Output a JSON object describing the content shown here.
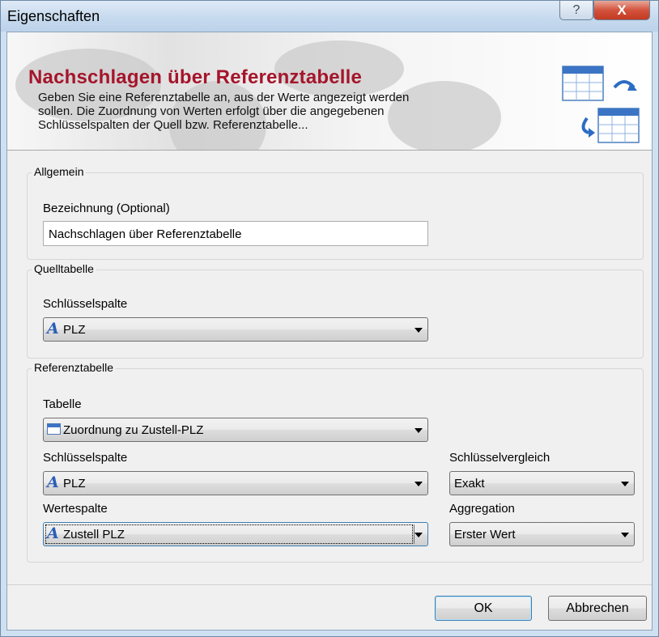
{
  "window": {
    "title": "Eigenschaften",
    "help_label": "?",
    "close_label": "X"
  },
  "banner": {
    "title": "Nachschlagen über Referenztabelle",
    "description_lines": [
      "Geben Sie eine Referenztabelle an, aus der Werte angezeigt werden",
      "sollen. Die Zuordnung von Werten erfolgt über die angegebenen",
      "Schlüsselspalten der Quell bzw. Referenztabelle..."
    ],
    "icon": "table-lookup-icon"
  },
  "allgemein": {
    "legend": "Allgemein",
    "name_label": "Bezeichnung (Optional)",
    "name_value": "Nachschlagen über Referenztabelle"
  },
  "quelltabelle": {
    "legend": "Quelltabelle",
    "key_label": "Schlüsselspalte",
    "key_value": "PLZ",
    "key_icon": "text-column-icon"
  },
  "referenztabelle": {
    "legend": "Referenztabelle",
    "table_label": "Tabelle",
    "table_value": "Zuordnung zu Zustell-PLZ",
    "table_icon": "table-icon",
    "key_label": "Schlüsselspalte",
    "key_value": "PLZ",
    "compare_label": "Schlüsselvergleich",
    "compare_value": "Exakt",
    "value_label": "Wertespalte",
    "value_value": "Zustell PLZ",
    "aggregation_label": "Aggregation",
    "aggregation_value": "Erster Wert"
  },
  "buttons": {
    "ok": "OK",
    "cancel": "Abbrechen"
  },
  "colors": {
    "banner_title": "#a5152b",
    "column_icon": "#2b5eb8",
    "close_button": "#c43a22"
  }
}
